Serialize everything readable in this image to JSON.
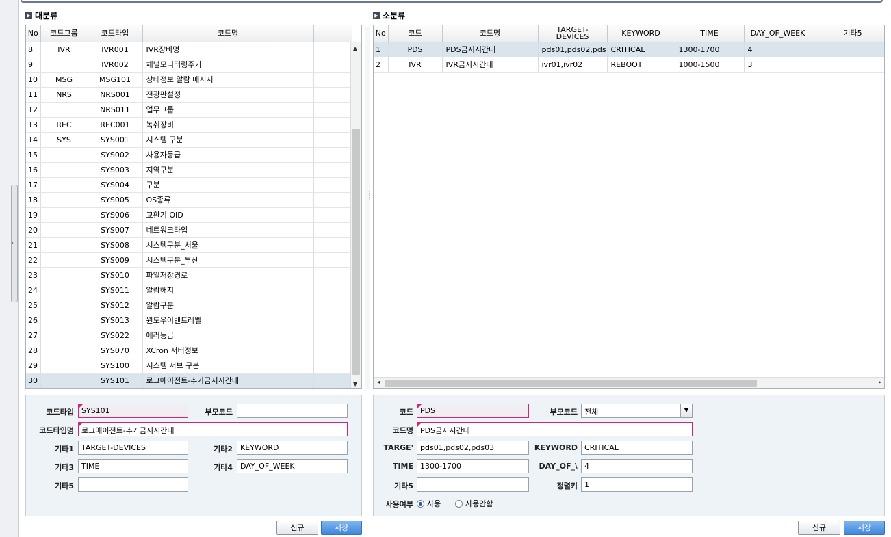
{
  "left": {
    "title": "대분류",
    "headers": [
      "No",
      "코드그룹",
      "코드타입",
      "코드명"
    ],
    "rows": [
      {
        "no": "8",
        "group": "IVR",
        "type": "IVR001",
        "name": "IVR장비명"
      },
      {
        "no": "9",
        "group": "",
        "type": "IVR002",
        "name": "채널모니터링주기"
      },
      {
        "no": "10",
        "group": "MSG",
        "type": "MSG101",
        "name": "상태정보 알람 메시지"
      },
      {
        "no": "11",
        "group": "NRS",
        "type": "NRS001",
        "name": "전광판설정"
      },
      {
        "no": "12",
        "group": "",
        "type": "NRS011",
        "name": "업무그룹"
      },
      {
        "no": "13",
        "group": "REC",
        "type": "REC001",
        "name": "녹취장비"
      },
      {
        "no": "14",
        "group": "SYS",
        "type": "SYS001",
        "name": "시스템 구분"
      },
      {
        "no": "15",
        "group": "",
        "type": "SYS002",
        "name": "사용자등급"
      },
      {
        "no": "16",
        "group": "",
        "type": "SYS003",
        "name": "지역구분"
      },
      {
        "no": "17",
        "group": "",
        "type": "SYS004",
        "name": "구분"
      },
      {
        "no": "18",
        "group": "",
        "type": "SYS005",
        "name": "OS종류"
      },
      {
        "no": "19",
        "group": "",
        "type": "SYS006",
        "name": "교환기 OID"
      },
      {
        "no": "20",
        "group": "",
        "type": "SYS007",
        "name": "네트워크타입"
      },
      {
        "no": "21",
        "group": "",
        "type": "SYS008",
        "name": "시스템구분_서울"
      },
      {
        "no": "22",
        "group": "",
        "type": "SYS009",
        "name": "시스템구분_부산"
      },
      {
        "no": "23",
        "group": "",
        "type": "SYS010",
        "name": "파일저장경로"
      },
      {
        "no": "24",
        "group": "",
        "type": "SYS011",
        "name": "알람해지"
      },
      {
        "no": "25",
        "group": "",
        "type": "SYS012",
        "name": "알람구분"
      },
      {
        "no": "26",
        "group": "",
        "type": "SYS013",
        "name": "윈도우이벤트레벨"
      },
      {
        "no": "27",
        "group": "",
        "type": "SYS022",
        "name": "에러등급"
      },
      {
        "no": "28",
        "group": "",
        "type": "SYS070",
        "name": "XCron 서버정보"
      },
      {
        "no": "29",
        "group": "",
        "type": "SYS100",
        "name": "시스템 서브 구분"
      },
      {
        "no": "30",
        "group": "",
        "type": "SYS101",
        "name": "로그에이전트-추가금지시간대"
      }
    ],
    "selected_no": "30",
    "form": {
      "code_type_label": "코드타입",
      "code_type": "SYS101",
      "parent_code_label": "부모코드",
      "parent_code": "",
      "code_type_name_label": "코드타입명",
      "code_type_name": "로그에이전트-추가금지시간대",
      "etc1_label": "기타1",
      "etc1": "TARGET-DEVICES",
      "etc2_label": "기타2",
      "etc2": "KEYWORD",
      "etc3_label": "기타3",
      "etc3": "TIME",
      "etc4_label": "기타4",
      "etc4": "DAY_OF_WEEK",
      "etc5_label": "기타5",
      "etc5": ""
    },
    "new_label": "신규",
    "save_label": "저장"
  },
  "right": {
    "title": "소분류",
    "headers": [
      "No",
      "코드",
      "코드명",
      "TARGET-DEVICES",
      "KEYWORD",
      "TIME",
      "DAY_OF_WEEK",
      "기타5"
    ],
    "rows": [
      {
        "no": "1",
        "code": "PDS",
        "name": "PDS금지시간대",
        "target": "pds01,pds02,pds",
        "keyword": "CRITICAL",
        "time": "1300-1700",
        "dow": "4",
        "etc5": ""
      },
      {
        "no": "2",
        "code": "IVR",
        "name": "IVR금지시간대",
        "target": "ivr01,ivr02",
        "keyword": "REBOOT",
        "time": "1000-1500",
        "dow": "3",
        "etc5": ""
      }
    ],
    "form": {
      "code_label": "코드",
      "code": "PDS",
      "parent_code_label": "부모코드",
      "parent_code": "전체",
      "code_name_label": "코드명",
      "code_name": "PDS금지시간대",
      "target_label": "TARGE'",
      "target": "pds01,pds02,pds03",
      "keyword_label": "KEYWORD",
      "keyword": "CRITICAL",
      "time_label": "TIME",
      "time": "1300-1700",
      "dow_label": "DAY_OF_\\",
      "dow": "4",
      "etc5_label": "기타5",
      "etc5": "",
      "sort_label": "정렬키",
      "sort": "1",
      "use_label": "사용여부",
      "use_yes": "사용",
      "use_no": "사용안함"
    },
    "new_label": "신규",
    "save_label": "저장"
  }
}
